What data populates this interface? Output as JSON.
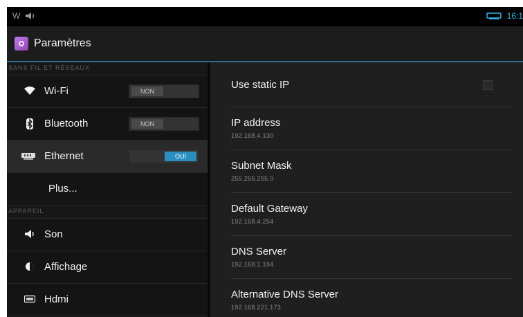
{
  "statusbar": {
    "left_text": "W",
    "time": "16:1"
  },
  "actionbar": {
    "title": "Paramètres"
  },
  "sidebar": {
    "sections": [
      {
        "header": "SANS FIL ET RÉSEAUX",
        "items": [
          {
            "label": "Wi-Fi",
            "icon": "wifi-icon",
            "toggle": "NON",
            "toggle_on": false
          },
          {
            "label": "Bluetooth",
            "icon": "bluetooth-icon",
            "toggle": "NON",
            "toggle_on": false
          },
          {
            "label": "Ethernet",
            "icon": "ethernet-icon",
            "toggle": "OUI",
            "toggle_on": true,
            "selected": true
          },
          {
            "label": "Plus..."
          }
        ]
      },
      {
        "header": "APPAREIL",
        "items": [
          {
            "label": "Son",
            "icon": "speaker-icon"
          },
          {
            "label": "Affichage",
            "icon": "brightness-icon"
          },
          {
            "label": "Hdmi",
            "icon": "hdmi-icon"
          }
        ]
      }
    ]
  },
  "ethernet": {
    "static_ip_label": "Use static IP",
    "fields": [
      {
        "title": "IP address",
        "value": "192.168.4.130"
      },
      {
        "title": "Subnet Mask",
        "value": "255.255.255.0"
      },
      {
        "title": "Default Gateway",
        "value": "192.168.4.254"
      },
      {
        "title": "DNS Server",
        "value": "192.168.1.194"
      },
      {
        "title": "Alternative DNS Server",
        "value": "192.168.221.173"
      }
    ]
  },
  "colors": {
    "accent": "#33b5e5",
    "toggle_on": "#2a8ec2",
    "background": "#111111"
  }
}
